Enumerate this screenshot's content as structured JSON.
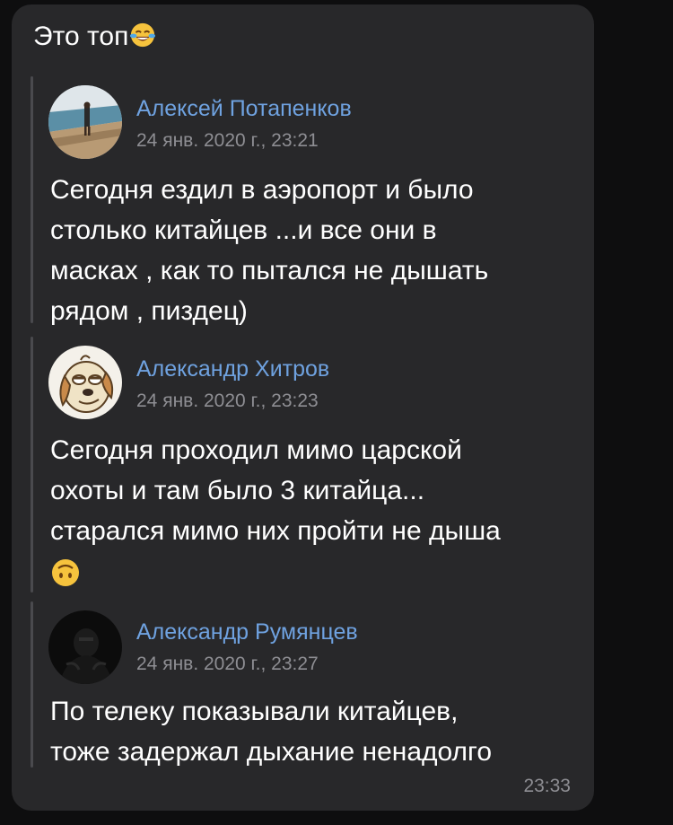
{
  "message": {
    "text": "Это топ",
    "emoji": "face-with-tears-of-joy",
    "time": "23:33"
  },
  "forwarded": [
    {
      "author": "Алексей Потапенков",
      "date": "24 янв. 2020 г., 23:21",
      "avatar": "beach-photo-avatar",
      "lines": [
        "Сегодня ездил в аэропорт и было",
        "столько китайцев ...и все они в",
        "масках , как то пытался не дышать",
        "рядом , пиздец)"
      ]
    },
    {
      "author": "Александр Хитров",
      "date": "24 янв. 2020 г., 23:23",
      "avatar": "cartoon-dog-avatar",
      "lines": [
        "Сегодня проходил мимо царской",
        "охоты и там было 3 китайца...",
        "старался мимо них пройти не дыша"
      ],
      "emoji": "upside-down-face"
    },
    {
      "author": "Александр Румянцев",
      "date": "24 янв. 2020 г., 23:27",
      "avatar": "dark-hooded-figure-avatar",
      "lines": [
        "По телеку показывали китайцев,",
        "тоже задержал дыхание ненадолго"
      ]
    }
  ],
  "colors": {
    "background": "#0e0e0f",
    "bubble": "#28282a",
    "author_link": "#6fa2e0",
    "meta_gray": "#8e8e93",
    "text": "#ffffff"
  }
}
